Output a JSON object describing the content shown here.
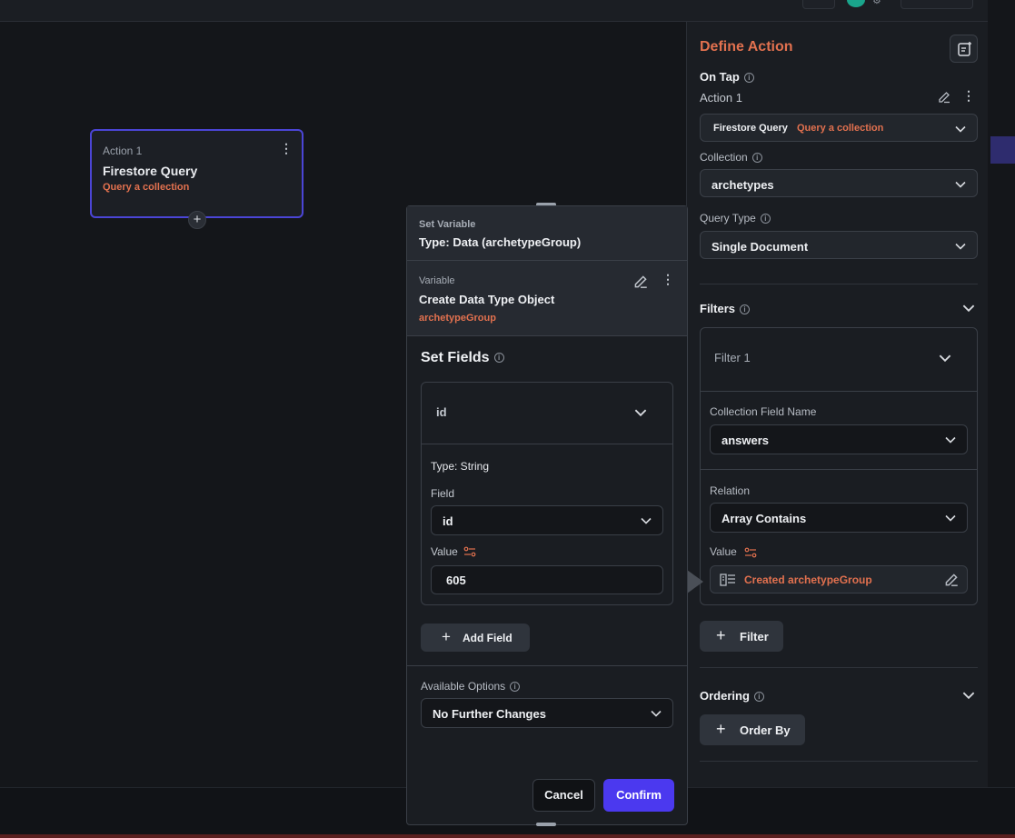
{
  "node": {
    "label": "Action 1",
    "title": "Firestore Query",
    "subtitle": "Query a collection"
  },
  "set_variable_panel": {
    "kicker": "Set Variable",
    "type_line": "Type: Data (archetypeGroup)",
    "variable": {
      "kicker": "Variable",
      "title": "Create Data Type Object",
      "subtitle": "archetypeGroup"
    },
    "set_fields_title": "Set Fields",
    "field": {
      "name": "id",
      "type_line": "Type: String",
      "field_label": "Field",
      "field_value": "id",
      "value_label": "Value",
      "value": "605"
    },
    "add_field_label": "Add Field",
    "available_options_label": "Available Options",
    "available_options_value": "No Further Changes",
    "cancel_label": "Cancel",
    "confirm_label": "Confirm"
  },
  "right_panel": {
    "title": "Define Action",
    "on_tap_label": "On Tap",
    "action_name": "Action 1",
    "action_select": {
      "primary": "Firestore Query",
      "secondary": "Query a collection"
    },
    "collection_label": "Collection",
    "collection_value": "archetypes",
    "query_type_label": "Query Type",
    "query_type_value": "Single Document",
    "filters_label": "Filters",
    "filter": {
      "name": "Filter 1",
      "collection_field_label": "Collection Field Name",
      "collection_field_value": "answers",
      "relation_label": "Relation",
      "relation_value": "Array Contains",
      "value_label": "Value",
      "value_text": "Created archetypeGroup"
    },
    "add_filter_label": "Filter",
    "ordering_label": "Ordering",
    "order_by_label": "Order By"
  },
  "colors": {
    "accent_orange": "#e2714f",
    "primary_purple": "#4b39ef",
    "node_border": "#4b45d6"
  }
}
